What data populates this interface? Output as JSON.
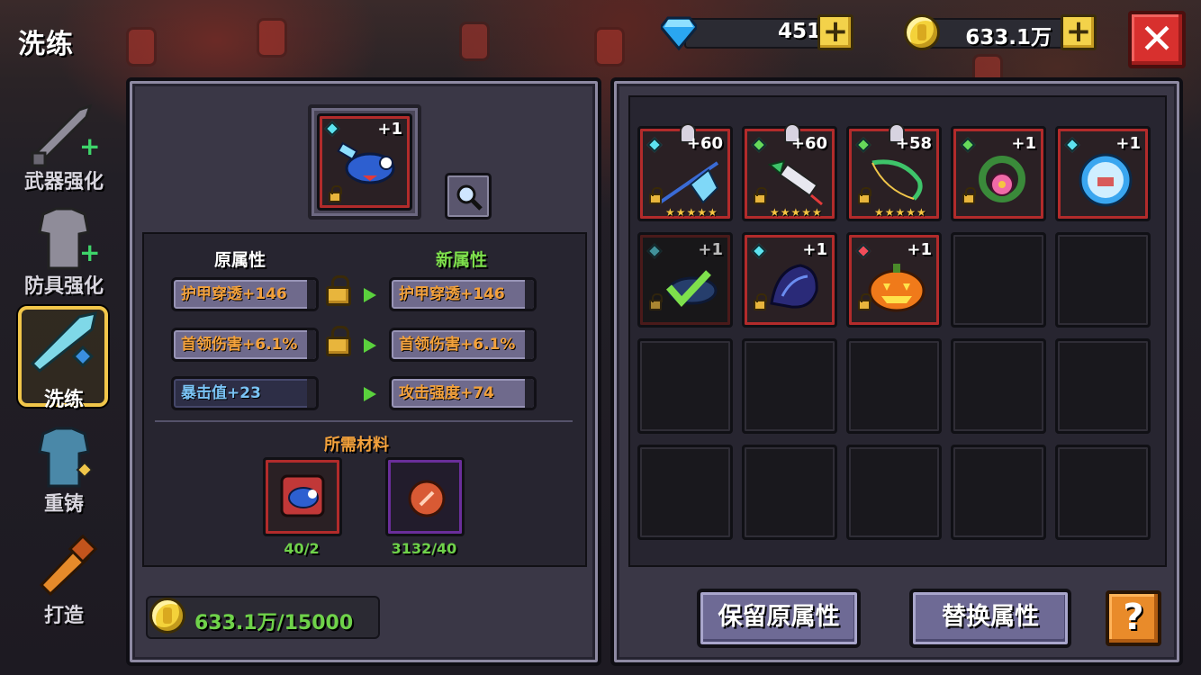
{
  "header": {
    "title": "洗练"
  },
  "currency": {
    "gems": {
      "value": "4513",
      "plus": "+"
    },
    "gold": {
      "value": "633.1万",
      "plus": "+"
    },
    "close": "✕"
  },
  "nav": [
    {
      "label": "武器强化"
    },
    {
      "label": "防具强化"
    },
    {
      "label": "洗练"
    },
    {
      "label": "重铸"
    },
    {
      "label": "打造"
    }
  ],
  "refine": {
    "selected_item_level": "+1",
    "old_header": "原属性",
    "new_header": "新属性",
    "rows": [
      {
        "old": "护甲穿透+146",
        "new": "护甲穿透+146",
        "locked": true
      },
      {
        "old": "首领伤害+6.1%",
        "new": "首领伤害+6.1%",
        "locked": true
      },
      {
        "old": "暴击值+23",
        "new": "攻击强度+74",
        "locked": false
      }
    ],
    "materials_title": "所需材料",
    "materials": [
      {
        "count": "40/2"
      },
      {
        "count": "3132/40"
      }
    ],
    "cost": "633.1万/15000"
  },
  "inventory": {
    "items": [
      {
        "level": "+60",
        "stars": "★★★★★",
        "gem_color": "#5de3f0"
      },
      {
        "level": "+60",
        "stars": "★★★★★",
        "gem_color": "#66d95a"
      },
      {
        "level": "+58",
        "stars": "★★★★★",
        "gem_color": "#66d95a"
      },
      {
        "level": "+1",
        "stars": "",
        "gem_color": "#66d95a"
      },
      {
        "level": "+1",
        "stars": "",
        "gem_color": "#5de3f0"
      },
      {
        "level": "+1",
        "stars": "",
        "gem_color": "#5de3f0"
      },
      {
        "level": "+1",
        "stars": "",
        "gem_color": "#5de3f0"
      },
      {
        "level": "+1",
        "stars": "",
        "gem_color": "#f04d5a"
      }
    ]
  },
  "buttons": {
    "keep": "保留原属性",
    "replace": "替换属性",
    "help": "?"
  },
  "colors": {
    "orange_text": "#f3a13b",
    "blue_text": "#7ac3f5",
    "green_text": "#6fd24a",
    "slot_red": "#b22b2b"
  }
}
